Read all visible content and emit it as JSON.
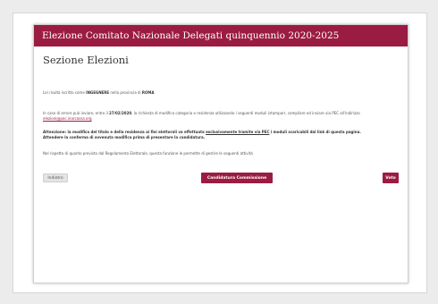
{
  "header": {
    "title": "Elezione Comitato Nazionale Delegati quinquennio 2020-2025"
  },
  "section": {
    "title": "Sezione Elezioni"
  },
  "registration": {
    "prefix": "Lei risulta iscritto come",
    "category": "INGEGNERE",
    "middle": "nella provincia di",
    "province": "ROMA"
  },
  "notice": {
    "prefix": "In caso di errore può inviare, entro il",
    "deadline": "27/02/2020",
    "middle": ", la richiesta di modifica categoria e residenza utilizzando i seguenti moduli (stamparr, compilare ed inviare via PEC all'indirizzo",
    "email": "elezioni@pec.inarcassa.org"
  },
  "warning": {
    "line1_prefix": "Attenzione: la modifica del titolo e della residenza ai fini elettorali va effettuata",
    "line1_emph": "esclusivamente tramite via PEC",
    "line1_suffix": "i moduli scaricabili dal link di questa pagina.",
    "line2": "Attendere la conferma di avvenuta modifica prima di presentare la candidatura."
  },
  "rules_note": "Nel rispetto di quanto previsto dal Regolamento Elettorale, questa funzione le permette di gestire le seguenti attività",
  "buttons": {
    "back": "Indietro",
    "candidatura": "Candidatura Commissione",
    "voto": "Voto"
  },
  "colors": {
    "brand": "#9b1c42"
  }
}
